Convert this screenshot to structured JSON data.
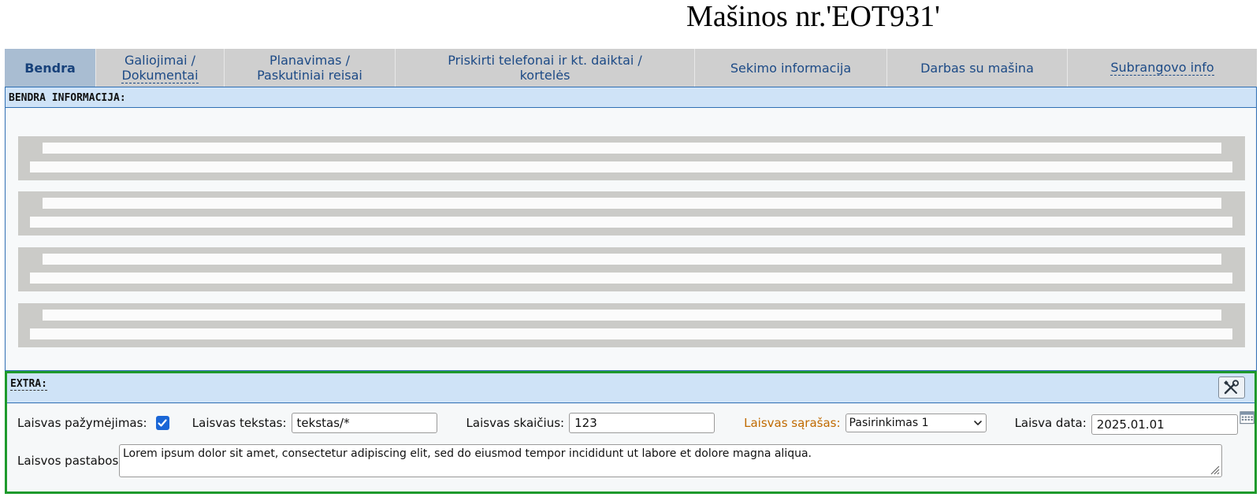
{
  "page": {
    "title": "Mašinos nr.'EOT931'"
  },
  "tabs": [
    {
      "label": "Bendra",
      "active": true
    },
    {
      "label": "Galiojimai / Dokumentai",
      "line1": "Galiojimai /",
      "line2": "Dokumentai"
    },
    {
      "label": "Planavimas / Paskutiniai reisai",
      "line1": "Planavimas /",
      "line2": "Paskutiniai reisai"
    },
    {
      "label": "Priskirti telefonai ir kt. daiktai / kortelės",
      "line1": "Priskirti telefonai ir kt. daiktai /",
      "line2": "kortelės"
    },
    {
      "label": "Sekimo informacija"
    },
    {
      "label": "Darbas su mašina"
    },
    {
      "label": "Subrangovo info"
    }
  ],
  "general": {
    "header": "BENDRA INFORMACIJA:"
  },
  "extra": {
    "header": "EXTRA:",
    "checkbox_label": "Laisvas pažymėjimas:",
    "checkbox_checked": true,
    "text_label": "Laisvas tekstas:",
    "text_value": "tekstas/*",
    "number_label": "Laisvas skaičius:",
    "number_value": "123",
    "list_label": "Laisvas sąrašas:",
    "list_value": "Pasirinkimas 1",
    "date_label": "Laisva data:",
    "date_value": "2025.01.01",
    "notes_label": "Laisvos pastabos:",
    "notes_value": "Lorem ipsum dolor sit amet, consectetur adipiscing elit, sed do eiusmod tempor incididunt ut labore et dolore magna aliqua."
  },
  "icons": {
    "tools": "tools-icon",
    "calendar": "calendar-icon",
    "dropdown": "chevron-down-icon",
    "check": "checkmark-icon"
  },
  "colors": {
    "tab_text": "#1c4a86",
    "active_tab_bg": "#a9bdd2",
    "section_header_bg": "#cfe3f7",
    "extra_border": "#1e9a2c",
    "list_label": "#c06a00",
    "checkbox": "#1a66d6"
  }
}
